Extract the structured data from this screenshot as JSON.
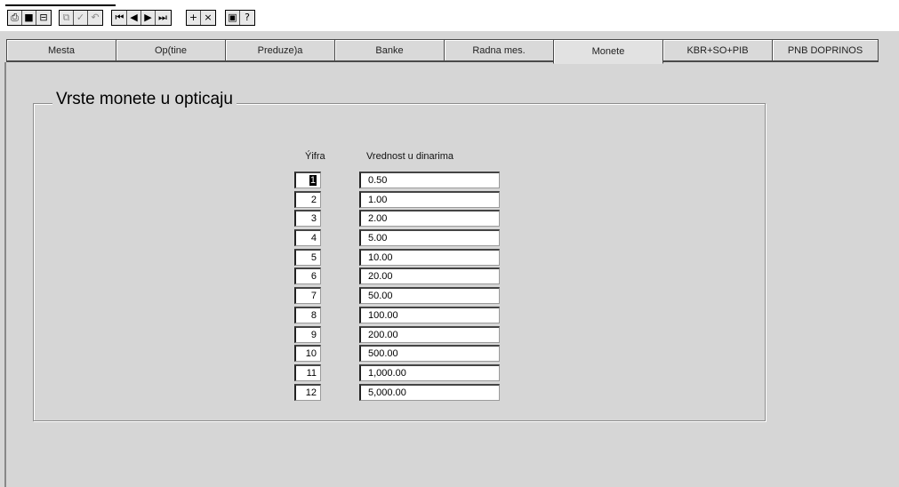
{
  "toolbar": {
    "groups": [
      {
        "name": "file",
        "icons": [
          "print-icon",
          "save-icon",
          "export-icon"
        ]
      },
      {
        "name": "edit",
        "icons": [
          "copy-icon",
          "check-icon",
          "undo-icon"
        ]
      },
      {
        "name": "navigate",
        "icons": [
          "first-record-icon",
          "previous-record-icon",
          "next-record-icon",
          "last-record-icon"
        ]
      },
      {
        "name": "records",
        "icons": [
          "add-record-icon",
          "delete-record-icon"
        ]
      },
      {
        "name": "help",
        "icons": [
          "document-icon",
          "help-icon"
        ]
      }
    ]
  },
  "tabs": [
    {
      "label": "Mesta",
      "active": false
    },
    {
      "label": "Op(tine",
      "active": false
    },
    {
      "label": "Preduze)a",
      "active": false
    },
    {
      "label": "Banke",
      "active": false
    },
    {
      "label": "Radna mes.",
      "active": false
    },
    {
      "label": "Monete",
      "active": true
    },
    {
      "label": "KBR+SO+PIB",
      "active": false
    },
    {
      "label": "PNB DOPRINOS",
      "active": false
    }
  ],
  "group": {
    "title": "Vrste monete u opticaju",
    "col_sifra": "Ýifra",
    "col_vrednost": "Vrednost u dinarima",
    "rows": [
      {
        "sifra": "1",
        "vrednost": "0.50"
      },
      {
        "sifra": "2",
        "vrednost": "1.00"
      },
      {
        "sifra": "3",
        "vrednost": "2.00"
      },
      {
        "sifra": "4",
        "vrednost": "5.00"
      },
      {
        "sifra": "5",
        "vrednost": "10.00"
      },
      {
        "sifra": "6",
        "vrednost": "20.00"
      },
      {
        "sifra": "7",
        "vrednost": "50.00"
      },
      {
        "sifra": "8",
        "vrednost": "100.00"
      },
      {
        "sifra": "9",
        "vrednost": "200.00"
      },
      {
        "sifra": "10",
        "vrednost": "500.00"
      },
      {
        "sifra": "11",
        "vrednost": "1,000.00"
      },
      {
        "sifra": "12",
        "vrednost": "5,000.00"
      }
    ]
  }
}
